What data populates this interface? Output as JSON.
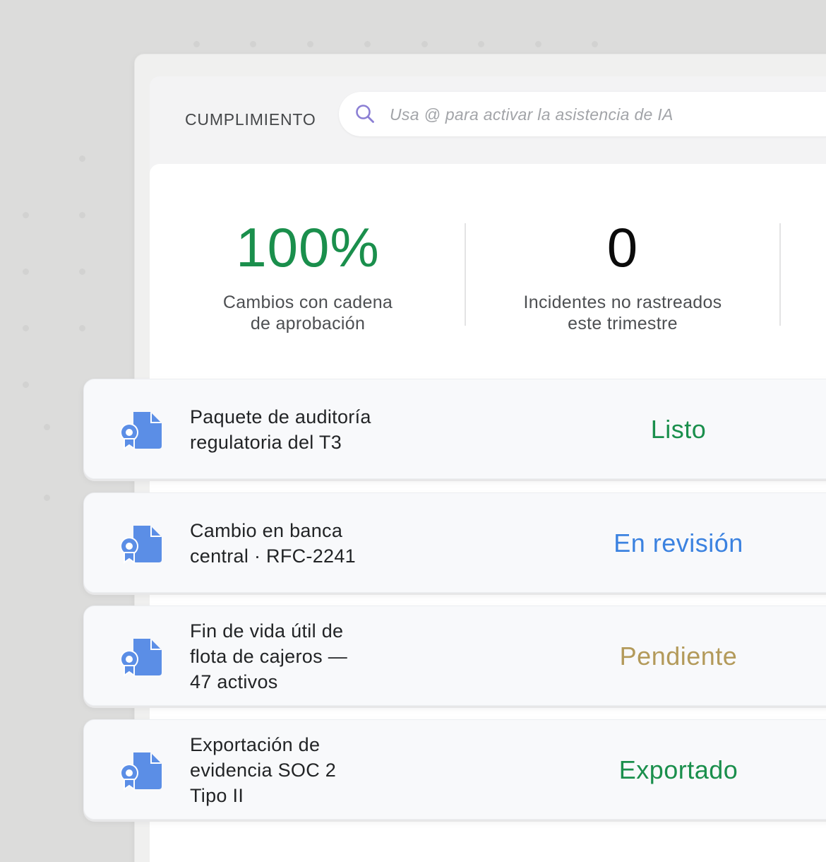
{
  "header": {
    "section_label": "CUMPLIMIENTO",
    "search_placeholder": "Usa @ para activar la asistencia de IA",
    "search_icon": "search-icon"
  },
  "stats": [
    {
      "value": "100%",
      "caption": "Cambios con cadena\nde aprobación",
      "color": "#1a8f4c"
    },
    {
      "value": "0",
      "caption": "Incidentes no rastreados\neste trimestre",
      "color": "#0b0b0b"
    }
  ],
  "items": [
    {
      "title": "Paquete de auditoría\nregulatoria del T3",
      "status": "Listo",
      "status_color": "#1a8f4c",
      "icon": "certificate-document-icon"
    },
    {
      "title": "Cambio en banca\ncentral · RFC-2241",
      "status": "En revisión",
      "status_color": "#3b82e0",
      "icon": "certificate-document-icon"
    },
    {
      "title": "Fin de vida útil de\nflota de cajeros —\n47 activos",
      "status": "Pendiente",
      "status_color": "#b39a5a",
      "icon": "certificate-document-icon"
    },
    {
      "title": "Exportación de\nevidencia SOC 2\nTipo II",
      "status": "Exportado",
      "status_color": "#1a8f4c",
      "icon": "certificate-document-icon"
    }
  ],
  "colors": {
    "accent_blue": "#5b8ee6",
    "search_icon": "#8b7fd4"
  }
}
